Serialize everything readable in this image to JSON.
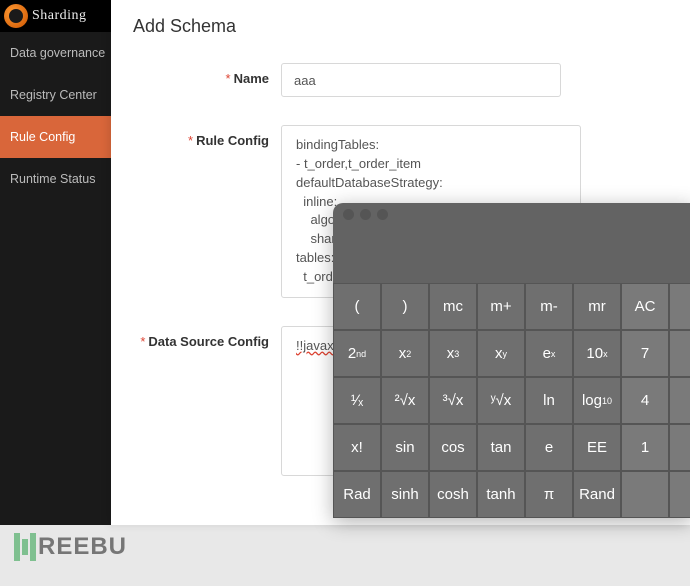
{
  "logo": {
    "text": "Sharding"
  },
  "sidebar": {
    "items": [
      {
        "label": "Data governance"
      },
      {
        "label": "Registry Center"
      },
      {
        "label": "Rule Config"
      },
      {
        "label": "Runtime Status"
      }
    ]
  },
  "panel": {
    "title": "Add Schema",
    "name_label": "Name",
    "name_value": "aaa",
    "rule_label": "Rule Config",
    "rule_value": "bindingTables:\n- t_order,t_order_item\ndefaultDatabaseStrategy:\n  inline:\n    algorithmExpression: ds_${user_id % 2}\n    shardingColumn: user_id\ntables:\n  t_order:",
    "ds_label": "Data Source Config",
    "ds_value": "!!javax"
  },
  "calculator": {
    "rows": [
      [
        "(",
        ")",
        "mc",
        "m+",
        "m-",
        "mr",
        "AC"
      ],
      [
        "2nd",
        "x2",
        "x3",
        "xy",
        "ex",
        "10x",
        "7"
      ],
      [
        "1/x",
        "2rx",
        "3rx",
        "yrx",
        "ln",
        "log10",
        "4"
      ],
      [
        "x!",
        "sin",
        "cos",
        "tan",
        "e",
        "EE",
        "1"
      ],
      [
        "Rad",
        "sinh",
        "cosh",
        "tanh",
        "pi",
        "Rand",
        ""
      ]
    ],
    "button_html": {
      "2nd": "2<sup>nd</sup>",
      "x2": "x<sup>2</sup>",
      "x3": "x<sup>3</sup>",
      "xy": "x<sup>y</sup>",
      "ex": "e<sup>x</sup>",
      "10x": "10<sup>x</sup>",
      "1/x": "¹∕ₓ",
      "2rx": "²√x",
      "3rx": "³√x",
      "yrx": "ʸ√x",
      "log10": "log<sub>10</sub>",
      "pi": "π"
    },
    "light_columns": [
      6,
      7
    ]
  },
  "watermark": "REEBU"
}
